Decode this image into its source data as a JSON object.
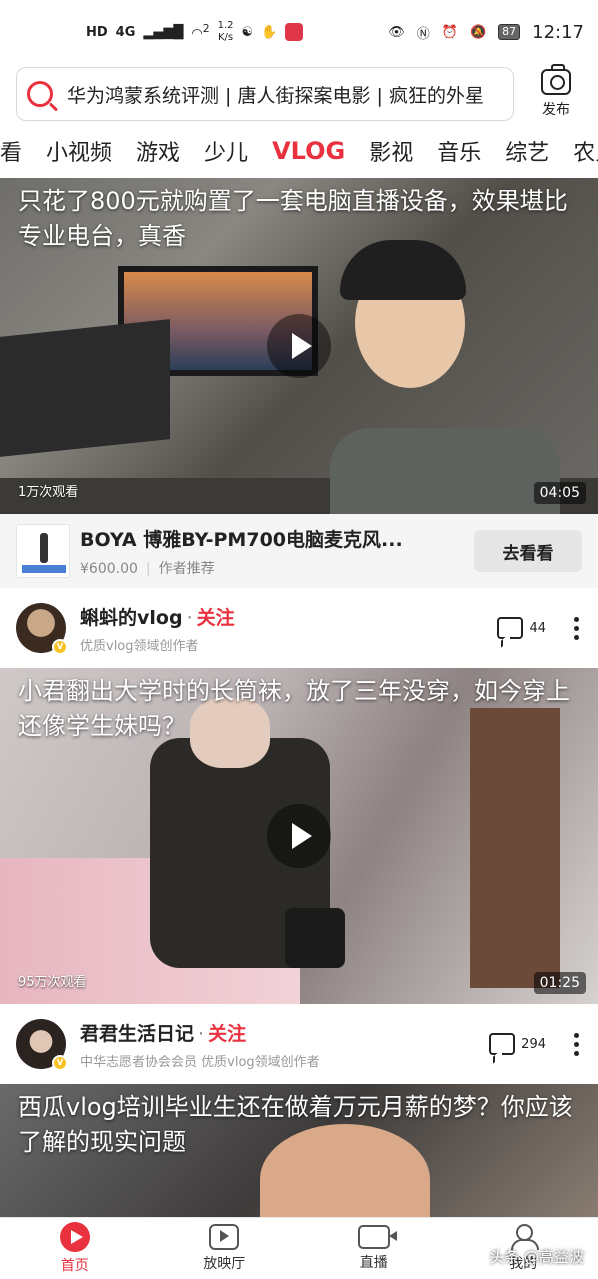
{
  "status_bar": {
    "left_badges": [
      "HD",
      "4G"
    ],
    "wifi_badge": "2",
    "net_speed_value": "1.2",
    "net_speed_unit": "K/s",
    "battery": "87",
    "time": "12:17"
  },
  "search": {
    "text": "华为鸿蒙系统评测 | 唐人街探案电影 | 疯狂的外星",
    "publish_label": "发布"
  },
  "tabs": [
    {
      "label": "看"
    },
    {
      "label": "小视频"
    },
    {
      "label": "游戏"
    },
    {
      "label": "少儿"
    },
    {
      "label": "VLOG"
    },
    {
      "label": "影视"
    },
    {
      "label": "音乐"
    },
    {
      "label": "综艺"
    },
    {
      "label": "农人"
    }
  ],
  "active_tab": "VLOG",
  "accent_color": "#e9313f",
  "feed": [
    {
      "title": "只花了800元就购置了一套电脑直播设备，效果堪比专业电台，真香",
      "views": "1万次观看",
      "duration": "04:05",
      "ad": {
        "title": "BOYA 博雅BY-PM700电脑麦克风...",
        "price": "¥600.00",
        "tag": "作者推荐",
        "button": "去看看"
      },
      "author": {
        "name": "蝌蚪的vlog",
        "follow": "关注",
        "desc": "优质vlog领域创作者",
        "comments": "44"
      }
    },
    {
      "title": "小君翻出大学时的长筒袜，放了三年没穿，如今穿上还像学生妹吗？",
      "views": "95万次观看",
      "duration": "01:25",
      "author": {
        "name": "君君生活日记",
        "follow": "关注",
        "desc": "中华志愿者协会会员 优质vlog领域创作者",
        "comments": "294"
      }
    },
    {
      "title": "西瓜vlog培训毕业生还在做着万元月薪的梦？你应该了解的现实问题"
    }
  ],
  "bottom_nav": [
    {
      "label": "首页",
      "icon": "home-play-icon"
    },
    {
      "label": "放映厅",
      "icon": "screening-hall-icon"
    },
    {
      "label": "直播",
      "icon": "live-camera-icon"
    },
    {
      "label": "我的",
      "icon": "profile-icon"
    }
  ],
  "watermark": "头条 @高益波"
}
